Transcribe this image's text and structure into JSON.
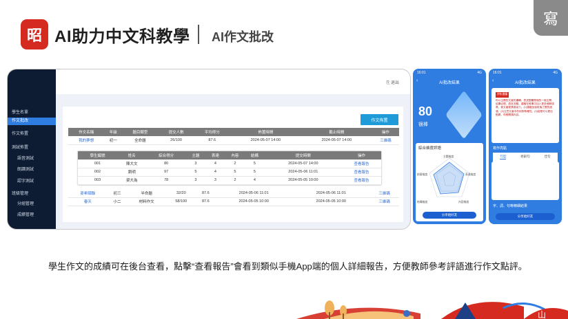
{
  "header": {
    "logo_glyph": "昭",
    "brand": "AI助力中文科教學",
    "subtitle": "AI作文批改",
    "corner_glyph": "寫"
  },
  "admin": {
    "exit_label": "退出",
    "cta_label": "作文佈置",
    "sidebar": {
      "section1": "學生名單",
      "item_active": "作文批改",
      "item2": "作文佈置",
      "section2": "測試佈置",
      "sub1": "語音測試",
      "sub2": "朗讀測試",
      "sub3": "認字測試",
      "section3": "班級管理",
      "sub4": "分組管理",
      "sub5": "成績管理"
    },
    "outer_headers": [
      "作文名稱",
      "年級",
      "題目類型",
      "提交人數",
      "平均得分",
      "佈置時間",
      "截止時間",
      "操作"
    ],
    "outer_rows": [
      [
        "我的夢想",
        "初一",
        "全命題",
        "26/100",
        "87.6",
        "2024-05-07 14:00",
        "2024-05-07 14:00",
        "三維碼"
      ]
    ],
    "inner_headers": [
      "學生編號",
      "姓名",
      "綜合得分",
      "主題",
      "表達",
      "內容",
      "結構",
      "提交時間",
      "操作"
    ],
    "inner_rows": [
      [
        "001",
        "陳大文",
        "80",
        "3",
        "4",
        "2",
        "5",
        "2024-05-07 14:00",
        "查看報告"
      ],
      [
        "002",
        "劉明",
        "97",
        "5",
        "4",
        "5",
        "5",
        "2024-05-06 11:01",
        "查看報告"
      ],
      [
        "003",
        "梁大為",
        "78",
        "3",
        "3",
        "2",
        "4",
        "2024-05-05 10:00",
        "查看報告"
      ]
    ],
    "outer_rows_bottom": [
      [
        "麥希頓聯",
        "初三",
        "半命題",
        "32/20",
        "87.6",
        "2024-05-06 11:01",
        "2024-05-06 11:01",
        "三維碼"
      ],
      [
        "春天",
        "小二",
        "材料作文",
        "58/100",
        "87.6",
        "2024-05-05 10:00",
        "2024-05-05 10:00",
        "三維碼"
      ]
    ]
  },
  "phone1": {
    "time": "16:01",
    "signal": "4G",
    "title": "AI批改結果",
    "score": "80",
    "grade": "很棒",
    "card_title": "綜合維度評語",
    "radar_labels": [
      "主題維度",
      "表達維度",
      "內容維度",
      "結構維度",
      "創意維度"
    ],
    "button": "分享給好友"
  },
  "phone2": {
    "time": "16:01",
    "signal": "4G",
    "title": "AI批改結果",
    "tag": "評析建議",
    "essay": "你以主題的文章的邏輯，表述整體是個的一個主題，結構合理，語言流暢。建議在敘事中加入更多細節描寫，使文章更具感染力。(1)建議加強段落之間的過渡。(2)注意文章中的用詞準確性。(3)結尾可以更加點題，呼應開頭內容。",
    "section": "寫作亮點",
    "tabs": [
      "句型",
      "修辭句",
      "佳句"
    ],
    "button": "分享給好友",
    "footer_label": "字、詞、句等精細結果"
  },
  "caption": "學生作文的成績可在後台查看，點擊“查看報告”會看到類似手機App端的個人詳細報告，方便教師參考評語進行作文點評。",
  "colors": {
    "brand_red": "#d42a1f",
    "admin_blue": "#2f7de1",
    "sidebar_navy": "#0d1b33",
    "cta_blue": "#1f9bd8"
  }
}
